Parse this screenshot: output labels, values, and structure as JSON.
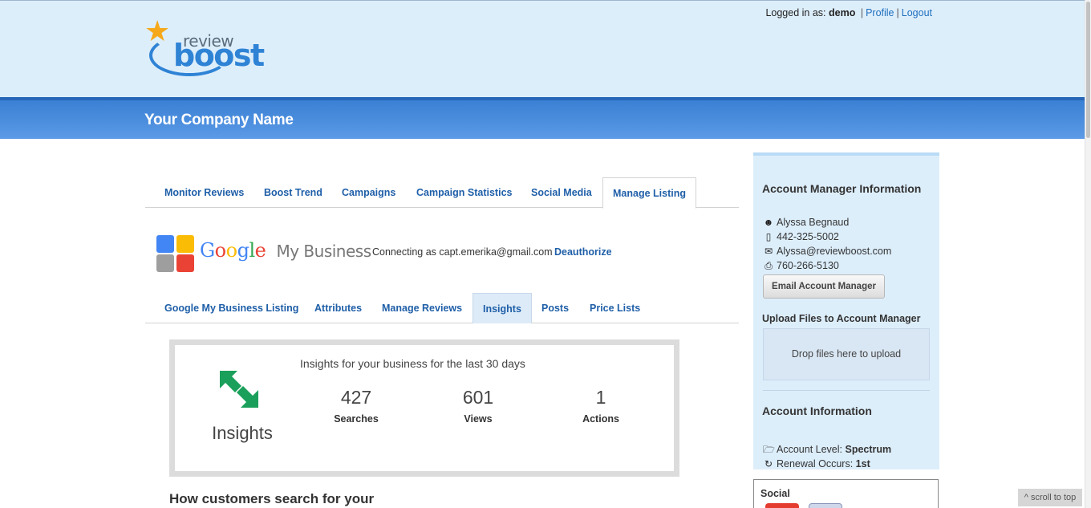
{
  "header": {
    "logged_in_prefix": "Logged in as:",
    "username": "demo",
    "profile_link": "Profile",
    "separator": "|",
    "logout_link": "Logout",
    "logo_small": "review",
    "logo_big": "boost"
  },
  "banner": {
    "company_name": "Your Company Name"
  },
  "main_tabs": [
    {
      "label": "Monitor Reviews"
    },
    {
      "label": "Boost Trend"
    },
    {
      "label": "Campaigns"
    },
    {
      "label": "Campaign Statistics"
    },
    {
      "label": "Social Media"
    },
    {
      "label": "Manage Listing",
      "active": true
    }
  ],
  "gmb": {
    "google_letters": [
      "G",
      "o",
      "o",
      "g",
      "l",
      "e"
    ],
    "my_business": "My Business",
    "connecting_text": "Connecting as capt.emerika@gmail.com",
    "deauthorize": "Deauthorize"
  },
  "sub_tabs": [
    {
      "label": "Google My Business Listing"
    },
    {
      "label": "Attributes"
    },
    {
      "label": "Manage Reviews"
    },
    {
      "label": "Insights",
      "active": true
    },
    {
      "label": "Posts"
    },
    {
      "label": "Price Lists"
    }
  ],
  "insights": {
    "heading": "Insights for your business for the last 30 days",
    "label": "Insights",
    "icon": "insights-arrows-icon",
    "metrics": [
      {
        "value": "427",
        "label": "Searches"
      },
      {
        "value": "601",
        "label": "Views"
      },
      {
        "value": "1",
        "label": "Actions"
      }
    ]
  },
  "section_heading": "How customers search for your",
  "sidebar": {
    "account_manager_title": "Account Manager Information",
    "manager_name": "Alyssa Begnaud",
    "manager_phone": "442-325-5002",
    "manager_email": "Alyssa@reviewboost.com",
    "manager_fax": "760-266-5130",
    "email_button": "Email Account Manager",
    "upload_title": "Upload Files to Account Manager",
    "drop_text": "Drop files here to upload",
    "account_info_title": "Account Information",
    "account_level_label": "Account Level:",
    "account_level_value": "Spectrum",
    "renewal_label": "Renewal Occurs:",
    "renewal_value": "1st",
    "icons": [
      "person-icon",
      "phone-icon",
      "envelope-icon",
      "fax-icon",
      "folder-icon",
      "refresh-icon"
    ]
  },
  "social": {
    "title": "Social"
  },
  "scroll_to_top": "^ scroll to top",
  "colors": {
    "header_bg": "#ddeefb",
    "banner_blue": "#4a8de0",
    "link_blue": "#1f5fa8",
    "insights_green": "#1aa05a"
  }
}
